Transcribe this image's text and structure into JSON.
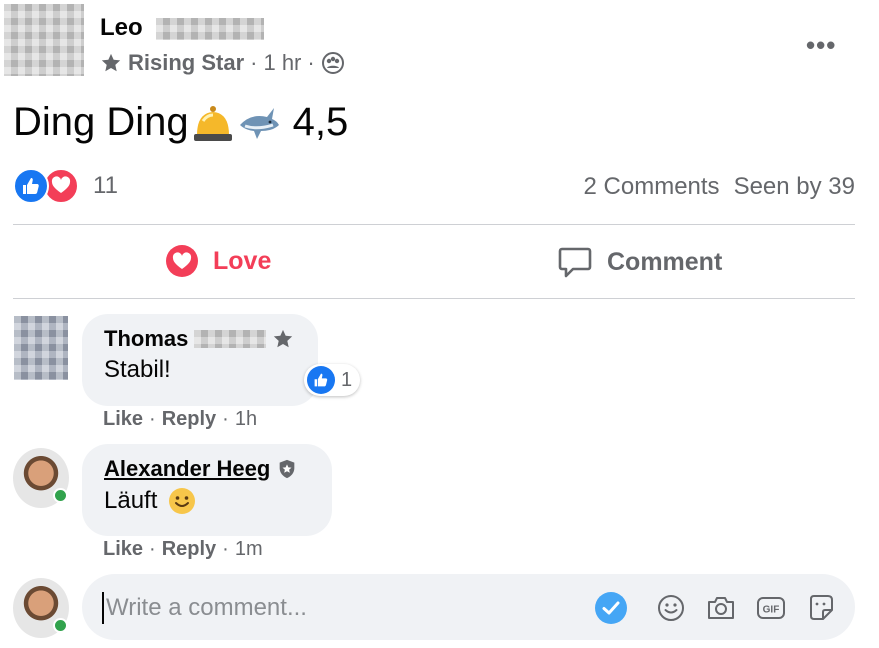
{
  "post": {
    "author_first": "Leo",
    "badge": "Rising Star",
    "dot1": "·",
    "time": "1 hr",
    "dot2": "·",
    "text": "Ding Ding",
    "text_tail": "4,5",
    "more_label": "•••"
  },
  "reactions": {
    "count": "11",
    "comments": "2 Comments",
    "seen": "Seen by 39"
  },
  "actions": {
    "love": "Love",
    "comment": "Comment"
  },
  "comments": [
    {
      "author": "Thomas",
      "text": "Stabil!",
      "like": "Like",
      "sep1": "·",
      "reply": "Reply",
      "sep2": "·",
      "time": "1h",
      "reaction_count": "1"
    },
    {
      "author": "Alexander Heeg",
      "text": "Läuft",
      "like": "Like",
      "sep1": "·",
      "reply": "Reply",
      "sep2": "·",
      "time": "1m"
    }
  ],
  "composer": {
    "placeholder": "Write a comment..."
  },
  "colors": {
    "like_blue": "#1877f2",
    "love_red": "#f33e58",
    "online_green": "#31a24c",
    "bubble_gray": "#f0f2f5"
  },
  "icons": [
    "star-icon",
    "group-icon",
    "bell-icon",
    "shark-icon",
    "like-icon",
    "love-icon",
    "comment-icon",
    "shield-icon",
    "smile-icon",
    "check-icon",
    "emoji-icon",
    "camera-icon",
    "gif-icon",
    "sticker-icon"
  ]
}
